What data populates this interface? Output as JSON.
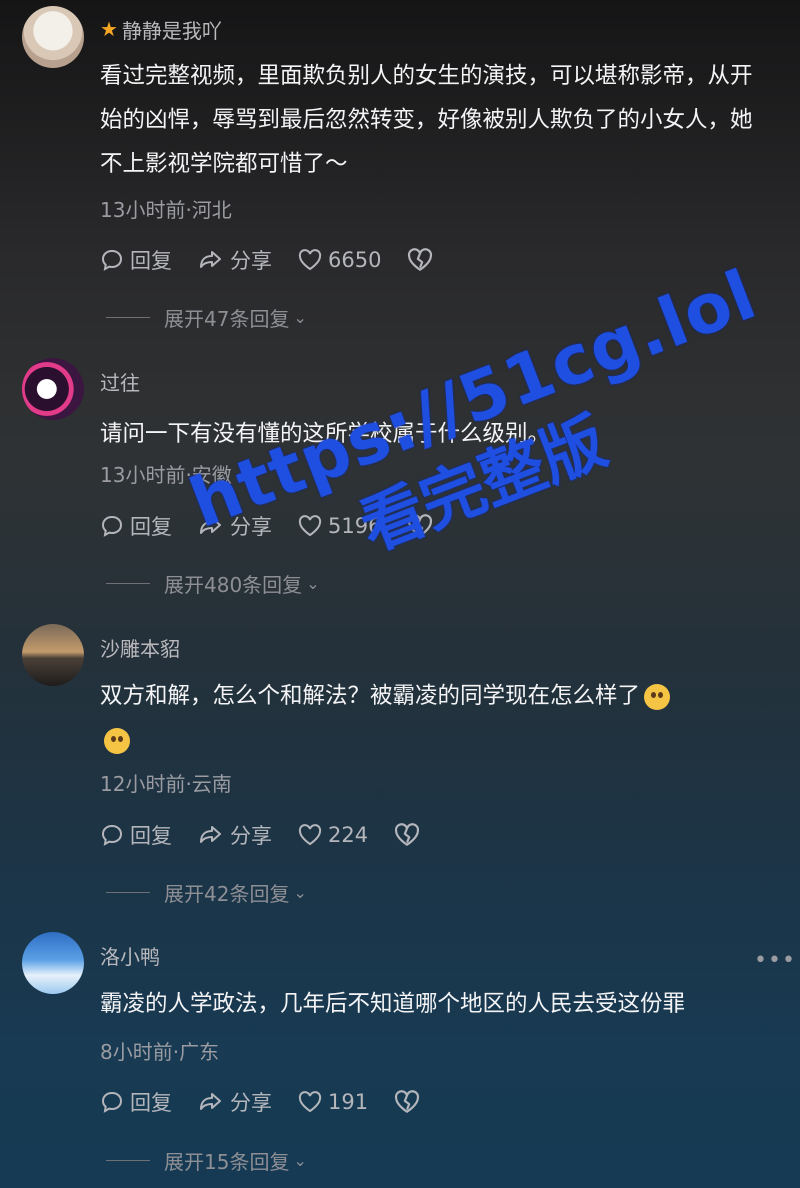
{
  "comments": [
    {
      "username": "静静是我吖",
      "starred": true,
      "text": "看过完整视频，里面欺负别人的女生的演技，可以堪称影帝，从开始的凶悍，辱骂到最后忽然转变，好像被别人欺负了的小女人，她不上影视学院都可惜了～",
      "time_location": "13小时前·河北",
      "reply_label": "回复",
      "share_label": "分享",
      "likes": "6650",
      "expand_label": "展开47条回复"
    },
    {
      "username": "过往",
      "text": "请问一下有没有懂的这所学校属于什么级别。",
      "time_location": "13小时前·安徽",
      "reply_label": "回复",
      "share_label": "分享",
      "likes": "5196",
      "expand_label": "展开480条回复"
    },
    {
      "username": "沙雕本貂",
      "text": "双方和解，怎么个和解法？被霸凌的同学现在怎么样了",
      "time_location": "12小时前·云南",
      "reply_label": "回复",
      "share_label": "分享",
      "likes": "224",
      "expand_label": "展开42条回复"
    },
    {
      "username": "洛小鸭",
      "text": "霸凌的人学政法，几年后不知道哪个地区的人民去受这份罪",
      "time_location": "8小时前·广东",
      "reply_label": "回复",
      "share_label": "分享",
      "likes": "191",
      "expand_label": "展开15条回复",
      "more_icon": "more-dots-icon"
    }
  ],
  "watermark": {
    "line1": "https://51cg.lol",
    "line2": "看完整版",
    "color": "#1f4fe0"
  }
}
